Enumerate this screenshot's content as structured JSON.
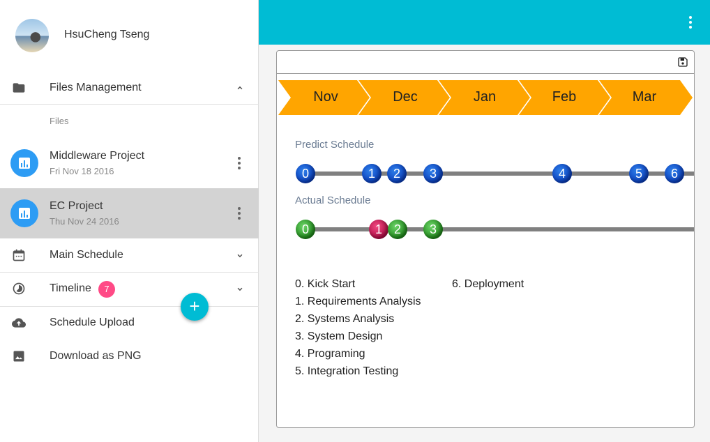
{
  "user": {
    "name": "HsuCheng Tseng"
  },
  "sidebar": {
    "files_management": "Files Management",
    "files_sub": "Files",
    "projects": [
      {
        "title": "Middleware Project",
        "date": "Fri Nov 18 2016"
      },
      {
        "title": "EC Project",
        "date": "Thu Nov 24 2016"
      }
    ],
    "main_schedule": "Main Schedule",
    "timeline": "Timeline",
    "timeline_count": "7",
    "schedule_upload": "Schedule Upload",
    "download_png": "Download as PNG",
    "add_symbol": "+"
  },
  "timeline": {
    "months": [
      "Nov",
      "Dec",
      "Jan",
      "Feb",
      "Mar"
    ],
    "predict_label": "Predict Schedule",
    "actual_label": "Actual Schedule",
    "predict_points": [
      "0",
      "1",
      "2",
      "3",
      "4",
      "5",
      "6"
    ],
    "actual_points": [
      "0",
      "1",
      "2",
      "3"
    ],
    "legend": [
      "0. Kick Start",
      "1. Requirements Analysis",
      "2. Systems Analysis",
      "3. System Design",
      "4. Programing",
      "5. Integration Testing",
      "6. Deployment"
    ]
  },
  "colors": {
    "accent": "#00bcd4",
    "month_bar": "#ffa500",
    "predict_dot": "#0a3fbf",
    "actual_dot": "#1f8a1a",
    "late_dot": "#b00c45",
    "count_badge": "#ff4a86"
  }
}
